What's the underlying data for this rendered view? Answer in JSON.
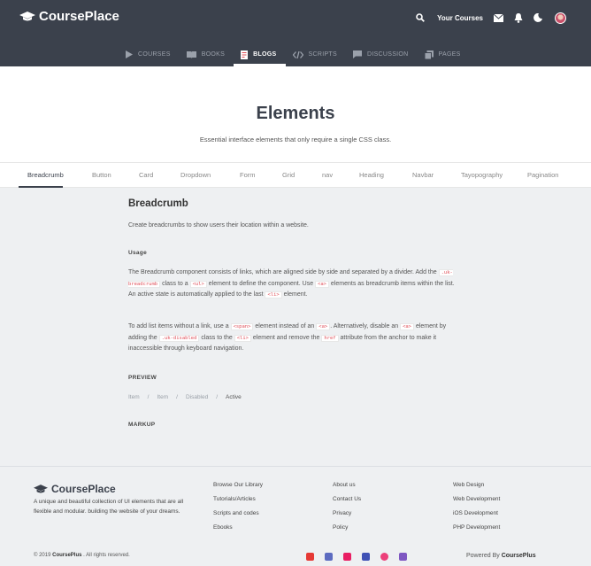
{
  "brand": {
    "name": "CoursePlace"
  },
  "topbar": {
    "your_courses": "Your Courses"
  },
  "tabs": [
    {
      "label": "COURSES",
      "icon": "play-icon"
    },
    {
      "label": "BOOKS",
      "icon": "book-icon"
    },
    {
      "label": "BLOGS",
      "icon": "document-icon",
      "active": true
    },
    {
      "label": "SCRIPTS",
      "icon": "code-icon"
    },
    {
      "label": "DISCUSSION",
      "icon": "chat-icon"
    },
    {
      "label": "PAGES",
      "icon": "pages-icon"
    }
  ],
  "hero": {
    "title": "Elements",
    "subtitle": "Essential interface elements that only require a single CSS class."
  },
  "subnav": [
    "Breadcrumb",
    "Button",
    "Card",
    "Dropdown",
    "Form",
    "Grid",
    "nav",
    "Heading",
    "Navbar",
    "Tayopography",
    "Pagination"
  ],
  "content": {
    "title": "Breadcrumb",
    "lead": "Create breadcrumbs to show users their location within a website.",
    "usage_heading": "Usage",
    "p1": {
      "t1": "The Breadcrumb component consists of links, which are aligned side by side and separated by a divider. Add the ",
      "c1": ".uk-breadcrumb",
      "t2": " class to a ",
      "c2": "<ul>",
      "t3": " element to define the component. Use ",
      "c3": "<a>",
      "t4": " elements as breadcrumb items within the list. An active state is automatically applied to the last ",
      "c4": "<li>",
      "t5": " element."
    },
    "p2": {
      "t1": "To add list items without a link, use a ",
      "c1": "<span>",
      "t2": " element instead of an ",
      "c2": "<a>",
      "t3": ". Alternatively, disable an ",
      "c3": "<a>",
      "t4": " element by adding the ",
      "c4": ".uk-disabled",
      "t5": " class to the ",
      "c5": "<li>",
      "t6": " element and remove the ",
      "c6": "href",
      "t7": " attribute from the anchor to make it inaccessible through keyboard navigation."
    },
    "preview_heading": "PREVIEW",
    "breadcrumb": [
      "Item",
      "Item",
      "Disabled",
      "Active"
    ],
    "markup_heading": "MARKUP"
  },
  "footer": {
    "name": "CoursePlace",
    "description": "A unique and beautiful collection of UI elements that are all flexible and modular. building the website of your dreams.",
    "col1": [
      "Browse Our Library",
      "Tutorials/Articles",
      "Scripts and codes",
      "Ebooks"
    ],
    "col2": [
      "About us",
      "Contact Us",
      "Privacy",
      "Policy"
    ],
    "col3": [
      "Web Design",
      "Web Development",
      "iOS Development",
      "PHP Development"
    ],
    "copyright_prefix": "© 2019 ",
    "copyright_brand": "CoursePlus",
    "copyright_suffix": " . All rights reserved.",
    "powered_prefix": "Powered By ",
    "powered_brand": "CoursePlus",
    "socials": [
      {
        "name": "youtube-icon",
        "color": "#e53935"
      },
      {
        "name": "facebook-icon",
        "color": "#5c6bc0"
      },
      {
        "name": "instagram-icon",
        "color": "#e91e63"
      },
      {
        "name": "linkedin-icon",
        "color": "#3f51b5"
      },
      {
        "name": "dribbble-icon",
        "color": "#ec407a"
      },
      {
        "name": "twitter-icon",
        "color": "#7e57c2"
      }
    ]
  }
}
